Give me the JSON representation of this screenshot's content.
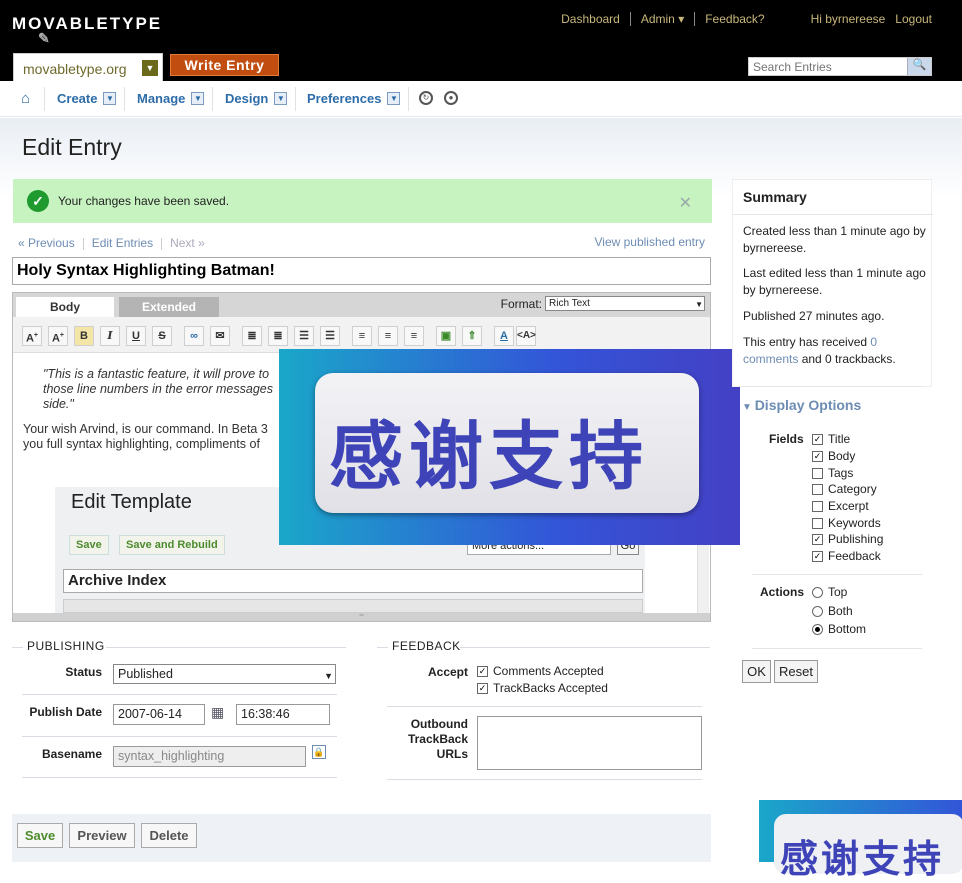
{
  "app": {
    "logo": "MOVABLETYPE"
  },
  "topnav": {
    "dashboard": "Dashboard",
    "admin": "Admin ▾",
    "feedback": "Feedback?",
    "greeting": "Hi byrnereese",
    "logout": "Logout"
  },
  "blog": {
    "name": "movabletype.org",
    "write_entry": "Write Entry"
  },
  "search": {
    "placeholder": "Search Entries"
  },
  "menu": {
    "create": "Create",
    "manage": "Manage",
    "design": "Design",
    "preferences": "Preferences"
  },
  "page": {
    "title": "Edit Entry"
  },
  "message": {
    "text": "Your changes have been saved."
  },
  "pager": {
    "previous": "« Previous",
    "edit_entries": "Edit Entries",
    "next": "Next »",
    "view_published": "View published entry"
  },
  "entry": {
    "title": "Holy Syntax Highlighting Batman!"
  },
  "editor": {
    "tab_body": "Body",
    "tab_extended": "Extended",
    "format_label": "Format:",
    "format_value": "Rich Text",
    "quote": "\"This is a fantastic feature, it will prove to those line numbers in the error messages side.\"",
    "paragraph": "Your wish Arvind, is our command. In Beta 3 you full syntax highlighting, compliments of",
    "template_title": "Edit Template",
    "template_save": "Save",
    "template_save_rebuild": "Save and Rebuild",
    "template_more": "More actions...",
    "template_go": "Go",
    "template_name": "Archive Index"
  },
  "banner": {
    "text": "感谢支持"
  },
  "summary": {
    "heading": "Summary",
    "created": "Created less than 1 minute ago by byrnereese.",
    "edited": "Last edited less than 1 minute ago by byrnereese.",
    "published": "Published 27 minutes ago.",
    "received_prefix": "This entry has received ",
    "comments_link": "0 comments",
    "received_suffix": " and 0 trackbacks."
  },
  "display_options": {
    "heading": "Display Options",
    "fields_label": "Fields",
    "fields": [
      {
        "label": "Title",
        "checked": true
      },
      {
        "label": "Body",
        "checked": true
      },
      {
        "label": "Tags",
        "checked": false
      },
      {
        "label": "Category",
        "checked": false
      },
      {
        "label": "Excerpt",
        "checked": false
      },
      {
        "label": "Keywords",
        "checked": false
      },
      {
        "label": "Publishing",
        "checked": true
      },
      {
        "label": "Feedback",
        "checked": true
      }
    ],
    "actions_label": "Actions",
    "actions": [
      {
        "label": "Top",
        "selected": false
      },
      {
        "label": "Both",
        "selected": false
      },
      {
        "label": "Bottom",
        "selected": true
      }
    ],
    "ok": "OK",
    "reset": "Reset"
  },
  "publishing": {
    "heading": "PUBLISHING",
    "status_label": "Status",
    "status_value": "Published",
    "date_label": "Publish Date",
    "date_value": "2007-06-14",
    "time_value": "16:38:46",
    "basename_label": "Basename",
    "basename_value": "syntax_highlighting"
  },
  "feedback": {
    "heading": "FEEDBACK",
    "accept_label": "Accept",
    "comments_accepted": "Comments Accepted",
    "trackbacks_accepted": "TrackBacks Accepted",
    "outbound_label": "Outbound TrackBack URLs"
  },
  "actions": {
    "save": "Save",
    "preview": "Preview",
    "delete": "Delete"
  },
  "colors": {
    "accent": "#c14e10",
    "link": "#6d8cb3",
    "success_bg": "#c7f3c0"
  }
}
